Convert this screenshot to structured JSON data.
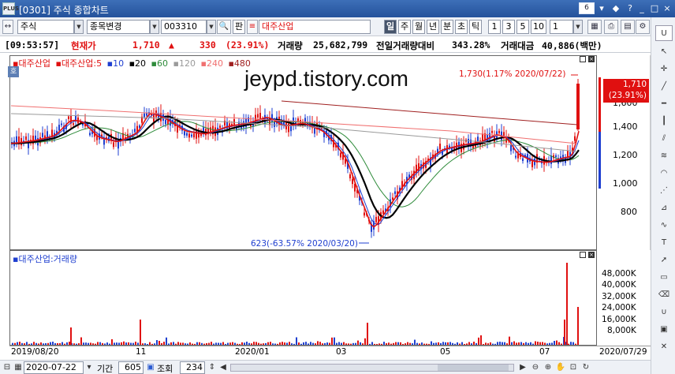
{
  "window": {
    "title": "[0301] 주식 종합차트",
    "app_badge": "PLUS",
    "linked_number": "6",
    "controls": [
      "▾",
      "◆",
      "?",
      "_",
      "□",
      "×"
    ]
  },
  "toolbar": {
    "market": "주식",
    "stock_change_label": "종목변경",
    "stock_code": "003310",
    "judge_label": "판",
    "stock_name": "대주산업",
    "periods": [
      "일",
      "주",
      "월",
      "년",
      "분",
      "초",
      "틱"
    ],
    "active_period": "일",
    "multipliers": [
      "1",
      "3",
      "5",
      "10"
    ],
    "unit_value": "1"
  },
  "quote": {
    "time": "[09:53:57]",
    "current_label": "현재가",
    "price": "1,710",
    "arrow": "▲",
    "change": "330",
    "change_pct": "(23.91%)",
    "volume_label": "거래량",
    "volume": "25,682,799",
    "prev_volume_label": "전일거래량대비",
    "prev_volume_ratio": "343.28%",
    "amount_label": "거래대금",
    "amount": "40,886(백만)"
  },
  "watermark": "jeypd.tistory.com",
  "price_pane": {
    "stock_label": "대주산업",
    "ma_label": "대주산업:5",
    "ma_periods": [
      "10",
      "20",
      "60",
      "120",
      "240",
      "480"
    ],
    "price_tag_side": "호",
    "high_annotation": "1,730(1.17% 2020/07/22)",
    "low_annotation": "623(-63.57% 2020/03/20)",
    "current_price_box": "1,710",
    "current_pct_box": "(23.91%)",
    "y_ticks": [
      "1,600",
      "1,400",
      "1,200",
      "1,000",
      "800"
    ]
  },
  "volume_pane": {
    "label": "대주산업:거래량",
    "y_ticks": [
      "48,000K",
      "40,000K",
      "32,000K",
      "24,000K",
      "16,000K",
      "8,000K"
    ]
  },
  "x_axis": {
    "labels": [
      "2019/08/20",
      "11",
      "2020/01",
      "03",
      "05",
      "07",
      "2020/07/29"
    ]
  },
  "bottom": {
    "date": "2020-07-22",
    "period_label": "기간",
    "period_value": "605",
    "query_label": "조회",
    "query_value": "234"
  },
  "colors": {
    "price_line": "#e01010",
    "ma5": "#e01010",
    "ma10": "#1f3fd0",
    "ma20": "#000000",
    "ma60": "#2e8b3a",
    "ma120": "#9a9a9a",
    "ma240": "#f07070",
    "ma480": "#a02020",
    "up": "#e01010",
    "down": "#1f3fd0"
  }
}
